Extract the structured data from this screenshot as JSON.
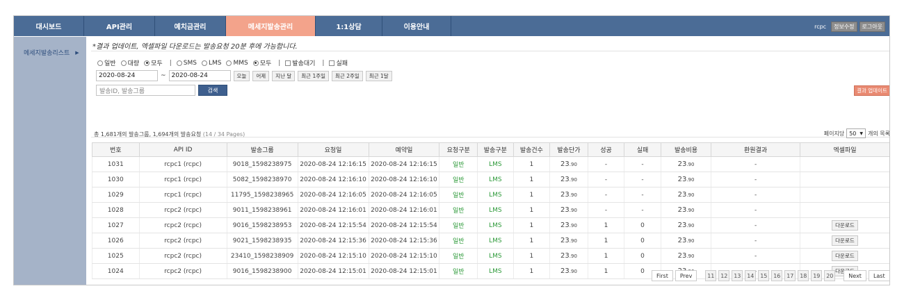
{
  "nav": {
    "items": [
      "대시보드",
      "API관리",
      "예치금관리",
      "메세지발송관리",
      "1:1상담",
      "이용안내"
    ],
    "active_index": 3,
    "user": "rcpc",
    "edit_label": "정보수정",
    "logout_label": "로그아웃"
  },
  "sidebar": {
    "item": "메세지발송리스트",
    "arrow": "▶"
  },
  "notice": "*결과 업데이트, 엑셀파일 다운로드는 발송요청 20분 후에 가능합니다.",
  "filters": {
    "type_options": [
      {
        "label": "일반",
        "checked": false
      },
      {
        "label": "대량",
        "checked": false
      },
      {
        "label": "모두",
        "checked": true
      }
    ],
    "msg_options": [
      {
        "label": "SMS",
        "checked": false
      },
      {
        "label": "LMS",
        "checked": false
      },
      {
        "label": "MMS",
        "checked": false
      },
      {
        "label": "모두",
        "checked": true
      }
    ],
    "wait_label": "발송대기",
    "fail_label": "실패",
    "date_from": "2020-08-24",
    "date_to": "2020-08-24",
    "tilde": "~",
    "quick_buttons": [
      "오늘",
      "어제",
      "지난 달",
      "최근 1주일",
      "최근 2주일",
      "최근 1달"
    ],
    "keyword_placeholder": "발송ID, 발송그룹",
    "search_label": "검색",
    "update_label": "결과 업데이트"
  },
  "summary": {
    "text": "총 1,681개의 발송그룹, 1,694개의 발송요청",
    "pages": "(14 / 34 Pages)"
  },
  "per_page": {
    "label": "페이지당",
    "value": "50",
    "arrow": "▼",
    "suffix": "개의 목록"
  },
  "table": {
    "headers": [
      "번호",
      "API ID",
      "발송그룹",
      "요청일",
      "예약일",
      "요청구분",
      "발송구분",
      "발송건수",
      "발송단가",
      "성공",
      "실패",
      "발송비용",
      "환원결과",
      "엑셀파일"
    ],
    "rows": [
      {
        "no": "1031",
        "api": "rcpc1 (rcpc)",
        "group": "9018_1598238975",
        "req": "2020-08-24 12:16:15",
        "res": "2020-08-24 12:16:15",
        "rtype": "일반",
        "stype": "LMS",
        "count": "1",
        "unit_main": "23",
        "unit_dec": ".90",
        "success": "-",
        "fail": "-",
        "cost_main": "23",
        "cost_dec": ".90",
        "refund": "-",
        "excel": ""
      },
      {
        "no": "1030",
        "api": "rcpc1 (rcpc)",
        "group": "5082_1598238970",
        "req": "2020-08-24 12:16:10",
        "res": "2020-08-24 12:16:10",
        "rtype": "일반",
        "stype": "LMS",
        "count": "1",
        "unit_main": "23",
        "unit_dec": ".90",
        "success": "-",
        "fail": "-",
        "cost_main": "23",
        "cost_dec": ".90",
        "refund": "-",
        "excel": ""
      },
      {
        "no": "1029",
        "api": "rcpc1 (rcpc)",
        "group": "11795_1598238965",
        "req": "2020-08-24 12:16:05",
        "res": "2020-08-24 12:16:05",
        "rtype": "일반",
        "stype": "LMS",
        "count": "1",
        "unit_main": "23",
        "unit_dec": ".90",
        "success": "-",
        "fail": "-",
        "cost_main": "23",
        "cost_dec": ".90",
        "refund": "-",
        "excel": ""
      },
      {
        "no": "1028",
        "api": "rcpc2 (rcpc)",
        "group": "9011_1598238961",
        "req": "2020-08-24 12:16:01",
        "res": "2020-08-24 12:16:01",
        "rtype": "일반",
        "stype": "LMS",
        "count": "1",
        "unit_main": "23",
        "unit_dec": ".90",
        "success": "-",
        "fail": "-",
        "cost_main": "23",
        "cost_dec": ".90",
        "refund": "-",
        "excel": ""
      },
      {
        "no": "1027",
        "api": "rcpc2 (rcpc)",
        "group": "9016_1598238953",
        "req": "2020-08-24 12:15:54",
        "res": "2020-08-24 12:15:54",
        "rtype": "일반",
        "stype": "LMS",
        "count": "1",
        "unit_main": "23",
        "unit_dec": ".90",
        "success": "1",
        "fail": "0",
        "cost_main": "23",
        "cost_dec": ".90",
        "refund": "-",
        "excel": "다운로드"
      },
      {
        "no": "1026",
        "api": "rcpc2 (rcpc)",
        "group": "9021_1598238935",
        "req": "2020-08-24 12:15:36",
        "res": "2020-08-24 12:15:36",
        "rtype": "일반",
        "stype": "LMS",
        "count": "1",
        "unit_main": "23",
        "unit_dec": ".90",
        "success": "1",
        "fail": "0",
        "cost_main": "23",
        "cost_dec": ".90",
        "refund": "-",
        "excel": "다운로드"
      },
      {
        "no": "1025",
        "api": "rcpc2 (rcpc)",
        "group": "23410_1598238909",
        "req": "2020-08-24 12:15:10",
        "res": "2020-08-24 12:15:10",
        "rtype": "일반",
        "stype": "LMS",
        "count": "1",
        "unit_main": "23",
        "unit_dec": ".90",
        "success": "1",
        "fail": "0",
        "cost_main": "23",
        "cost_dec": ".90",
        "refund": "-",
        "excel": "다운로드"
      },
      {
        "no": "1024",
        "api": "rcpc2 (rcpc)",
        "group": "9016_1598238900",
        "req": "2020-08-24 12:15:01",
        "res": "2020-08-24 12:15:01",
        "rtype": "일반",
        "stype": "LMS",
        "count": "1",
        "unit_main": "23",
        "unit_dec": ".90",
        "success": "1",
        "fail": "0",
        "cost_main": "23",
        "cost_dec": ".90",
        "refund": "-",
        "excel": "다운로드"
      }
    ]
  },
  "pager": {
    "first": "First",
    "prev": "Prev",
    "pages": [
      "11",
      "12",
      "13",
      "14",
      "15",
      "16",
      "17",
      "18",
      "19",
      "20"
    ],
    "next": "Next",
    "last": "Last"
  },
  "colors": {
    "nav_bg": "#4b6c96",
    "nav_active": "#f3a38b",
    "sidebar_bg": "#a5b3c8",
    "green": "#2e9a3a",
    "update_btn": "#e98a72"
  }
}
